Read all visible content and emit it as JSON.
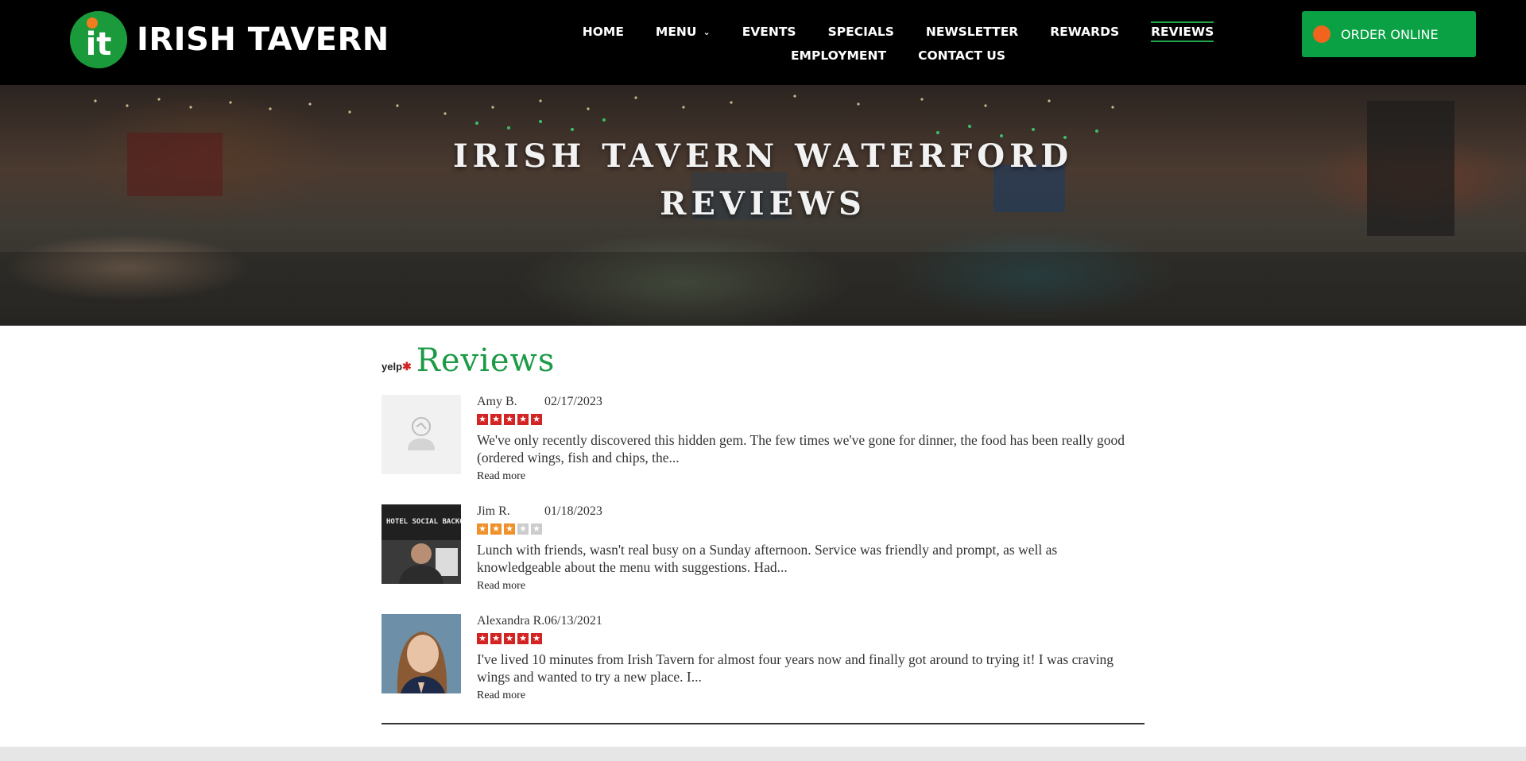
{
  "brand": {
    "logo_mark": "it",
    "name": "IRISH TAVERN"
  },
  "nav": {
    "items": [
      {
        "label": "HOME"
      },
      {
        "label": "MENU"
      },
      {
        "label": "EVENTS"
      },
      {
        "label": "SPECIALS"
      },
      {
        "label": "NEWSLETTER"
      },
      {
        "label": "REWARDS"
      },
      {
        "label": "REVIEWS",
        "active": true
      },
      {
        "label": "EMPLOYMENT"
      },
      {
        "label": "CONTACT US"
      }
    ],
    "order_button": "ORDER ONLINE"
  },
  "hero": {
    "title_line1": "IRISH TAVERN WATERFORD",
    "title_line2": "REVIEWS"
  },
  "reviews_section": {
    "source_logo": "yelp",
    "title": "Reviews",
    "read_more_label": "Read more",
    "items": [
      {
        "name": "Amy B.",
        "date": "02/17/2023",
        "rating": 5,
        "text": "We've only recently discovered this hidden gem. The few times we've gone for dinner, the food has been really good (ordered wings, fish and chips, the...",
        "avatar": "placeholder-avatar"
      },
      {
        "name": "Jim R.",
        "date": "01/18/2023",
        "rating": 3,
        "text": "Lunch with friends, wasn't real busy on a Sunday afternoon. Service was friendly and prompt, as well as knowledgeable about the menu with suggestions. Had...",
        "avatar": "photo-avatar-man",
        "avatar_sign_text": "HOTEL SOCIAL BACKGROU"
      },
      {
        "name": "Alexandra R.",
        "date": "06/13/2021",
        "rating": 5,
        "text": "I've lived 10 minutes from Irish Tavern for almost four years now and finally got around to trying it! I was craving wings and wanted to try a new place. I...",
        "avatar": "photo-avatar-woman"
      }
    ]
  },
  "colors": {
    "header_bg": "#000000",
    "brand_green": "#1c9a46",
    "order_button_bg": "#0aa145",
    "order_dot": "#f0641e",
    "star_red": "#d32323",
    "star_orange": "#f0902b",
    "star_empty": "#cccccc"
  }
}
